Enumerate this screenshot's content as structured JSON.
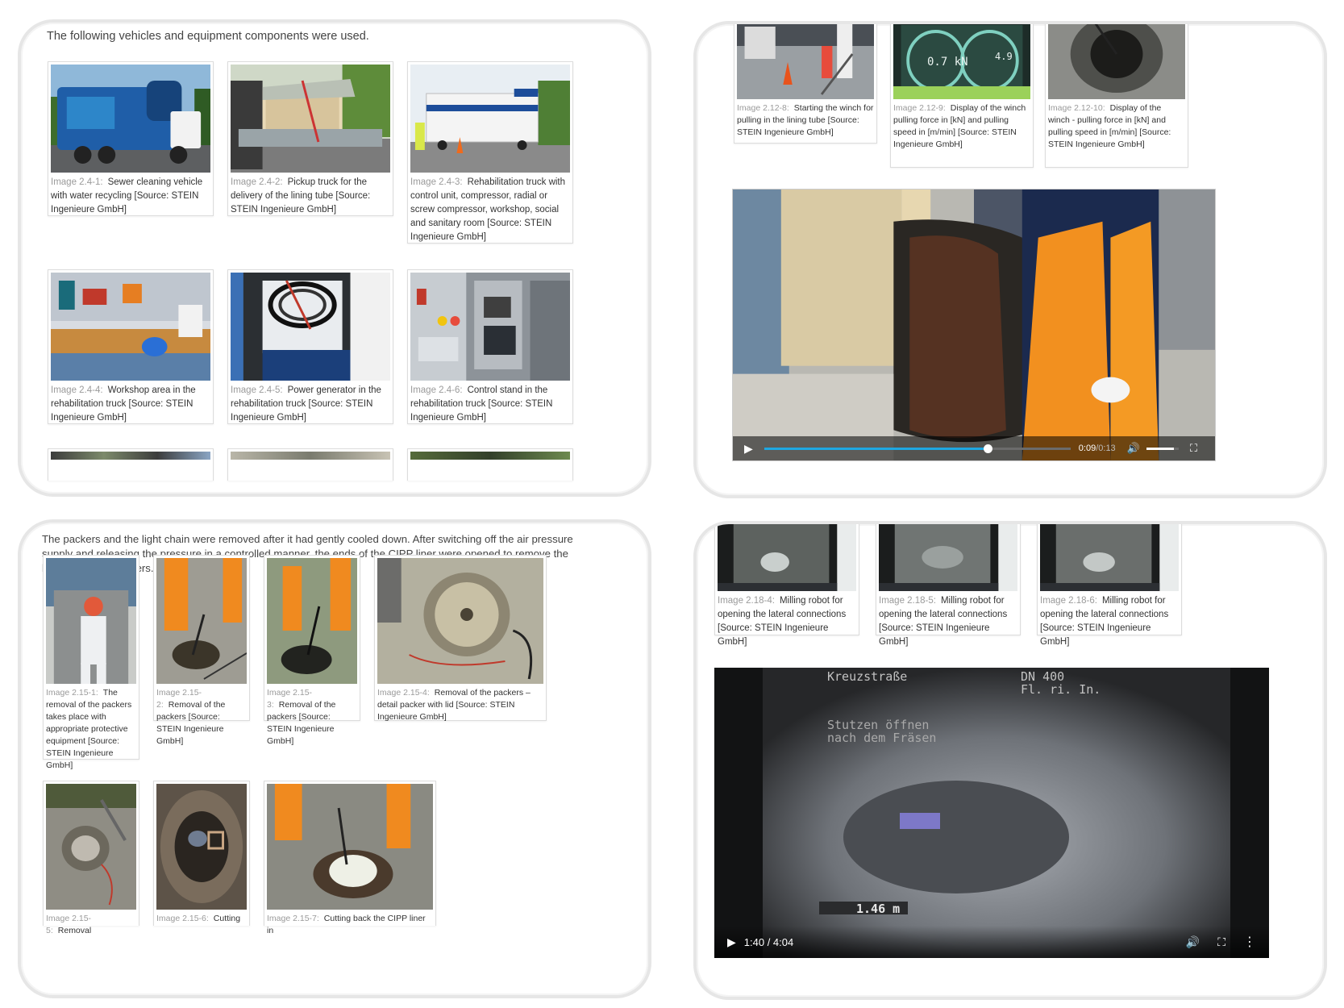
{
  "panel1": {
    "intro": "The following vehicles and equipment components were used.",
    "figures": [
      {
        "num": "Image 2.4-1:",
        "caption": "Sewer cleaning vehicle with water recycling [Source: STEIN Ingenieure GmbH]"
      },
      {
        "num": "Image 2.4-2:",
        "caption": "Pickup truck for the delivery of the lining tube [Source: STEIN Ingenieure GmbH]"
      },
      {
        "num": "Image 2.4-3:",
        "caption": "Rehabilitation truck with control unit, compressor, radial or screw compressor, workshop, social and sanitary room [Source: STEIN Ingenieure GmbH]"
      },
      {
        "num": "Image 2.4-4:",
        "caption": "Workshop area in the rehabilitation truck [Source: STEIN Ingenieure GmbH]"
      },
      {
        "num": "Image 2.4-5:",
        "caption": "Power generator in the rehabilitation truck [Source: STEIN Ingenieure GmbH]"
      },
      {
        "num": "Image 2.4-6:",
        "caption": "Control stand in the rehabilitation truck [Source: STEIN Ingenieure GmbH]"
      }
    ]
  },
  "panel2": {
    "figures": [
      {
        "num": "Image 2.12-8:",
        "caption": "Starting the winch for pulling in the lining tube [Source: STEIN Ingenieure GmbH]"
      },
      {
        "num": "Image 2.12-9:",
        "caption": "Display of the winch pulling force in [kN] and pulling speed in [m/min] [Source: STEIN Ingenieure GmbH]"
      },
      {
        "num": "Image 2.12-10:",
        "caption": "Display of the winch - pulling force in [kN] and pulling speed in [m/min] [Source: STEIN Ingenieure GmbH]"
      }
    ],
    "display_value": "0.7 kN",
    "display_value2": "4.9",
    "video": {
      "current": "0:09",
      "separator": " / ",
      "duration": "0:13",
      "progress": 0.73,
      "volume": 0.85
    }
  },
  "panel3": {
    "intro": "The packers and the light chain were removed after it had gently cooled down. After switching off the air pressure supply and releasing the pressure in a controlled manner, the ends of the CIPP liner were opened to remove the light chain and packers.",
    "figures": [
      {
        "num": "Image 2.15-1:",
        "caption": "The removal of the packers takes place with appropriate protective equipment [Source: STEIN Ingenieure GmbH]"
      },
      {
        "num": "Image 2.15-2:",
        "caption": "Removal of the packers [Source: STEIN Ingenieure GmbH]"
      },
      {
        "num": "Image 2.15-3:",
        "caption": "Removal of the packers [Source: STEIN Ingenieure GmbH]"
      },
      {
        "num": "Image 2.15-4:",
        "caption": "Removal of the packers – detail packer with lid [Source: STEIN Ingenieure GmbH]"
      },
      {
        "num": "Image 2.15-5:",
        "caption": "Removal"
      },
      {
        "num": "Image 2.15-6:",
        "caption": "Cutting"
      },
      {
        "num": "Image 2.15-7:",
        "caption": "Cutting back the CIPP liner in"
      }
    ]
  },
  "panel4": {
    "figures": [
      {
        "num": "Image 2.18-4:",
        "caption": "Milling robot for opening the lateral connections [Source: STEIN Ingenieure GmbH]"
      },
      {
        "num": "Image 2.18-5:",
        "caption": "Milling robot for opening the lateral connections [Source: STEIN Ingenieure GmbH]"
      },
      {
        "num": "Image 2.18-6:",
        "caption": "Milling robot for opening the lateral connections [Source: STEIN Ingenieure GmbH]"
      }
    ],
    "overlay": {
      "street": "Kreuzstraße",
      "dn": "DN 400",
      "flow": "Fl. ri. In.",
      "note1": "Stutzen öffnen",
      "note2": "nach dem Fräsen",
      "distance": "1.46 m"
    },
    "video": {
      "time": "1:40 / 4:04",
      "progress": 0.41
    }
  },
  "colors": {
    "progress": "#1ea7e1",
    "panel_border": "#e6e6e6",
    "caption_num": "#9a9a9a"
  }
}
